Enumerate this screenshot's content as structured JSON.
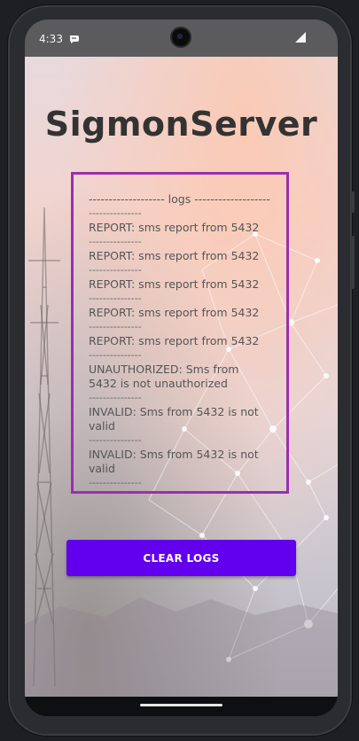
{
  "status_bar": {
    "time": "4:33"
  },
  "app": {
    "title": "SigmonServer",
    "logs_header": "------------------- logs --------------------",
    "divider": "---------------",
    "entries": [
      "REPORT: sms report from 5432",
      "REPORT: sms report from 5432",
      "REPORT: sms report from 5432",
      "REPORT: sms report from 5432",
      "REPORT: sms report from 5432",
      "UNAUTHORIZED: Sms from 5432 is not unauthorized",
      "INVALID: Sms from 5432 is not valid",
      "INVALID: Sms from 5432 is not valid"
    ],
    "clear_button_label": "CLEAR LOGS"
  },
  "colors": {
    "accent": "#6200ee",
    "log_border": "#9b2fae",
    "title_text": "#333333"
  },
  "icons": [
    "notification-icon",
    "camera-icon",
    "signal-icon"
  ]
}
